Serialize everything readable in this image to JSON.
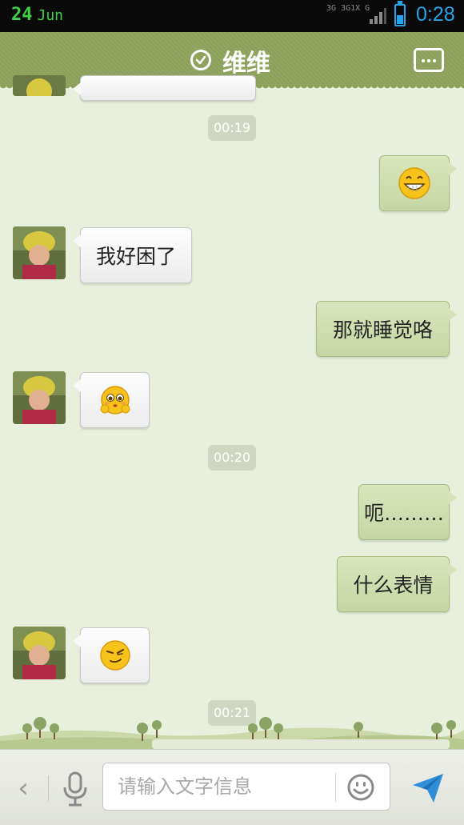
{
  "status_bar": {
    "date_day": "24",
    "date_month": "Jun",
    "network_line1": "3G 3G1X G",
    "time": "0:28",
    "battery_level": 0.45,
    "accent_color": "#27a5e8"
  },
  "header": {
    "title": "维维",
    "status_icon": "check-circle-icon",
    "menu_icon": "more-icon",
    "bar_color": "#8ca05a"
  },
  "messages": [
    {
      "type": "timestamp",
      "text": "00:19"
    },
    {
      "type": "outgoing",
      "emoji": "grin-emoji"
    },
    {
      "type": "incoming",
      "text": "我好困了"
    },
    {
      "type": "outgoing",
      "text": "那就睡觉咯"
    },
    {
      "type": "incoming",
      "emoji": "pitiful-emoji"
    },
    {
      "type": "timestamp",
      "text": "00:20"
    },
    {
      "type": "outgoing",
      "text": "呃………"
    },
    {
      "type": "outgoing",
      "text": "什么表情"
    },
    {
      "type": "incoming",
      "emoji": "smirk-emoji"
    },
    {
      "type": "timestamp",
      "text": "00:21"
    }
  ],
  "composer": {
    "placeholder": "请输入文字信息",
    "back_icon": "chevron-left-icon",
    "voice_icon": "microphone-icon",
    "emoji_icon": "smiley-icon",
    "send_icon": "send-icon"
  }
}
